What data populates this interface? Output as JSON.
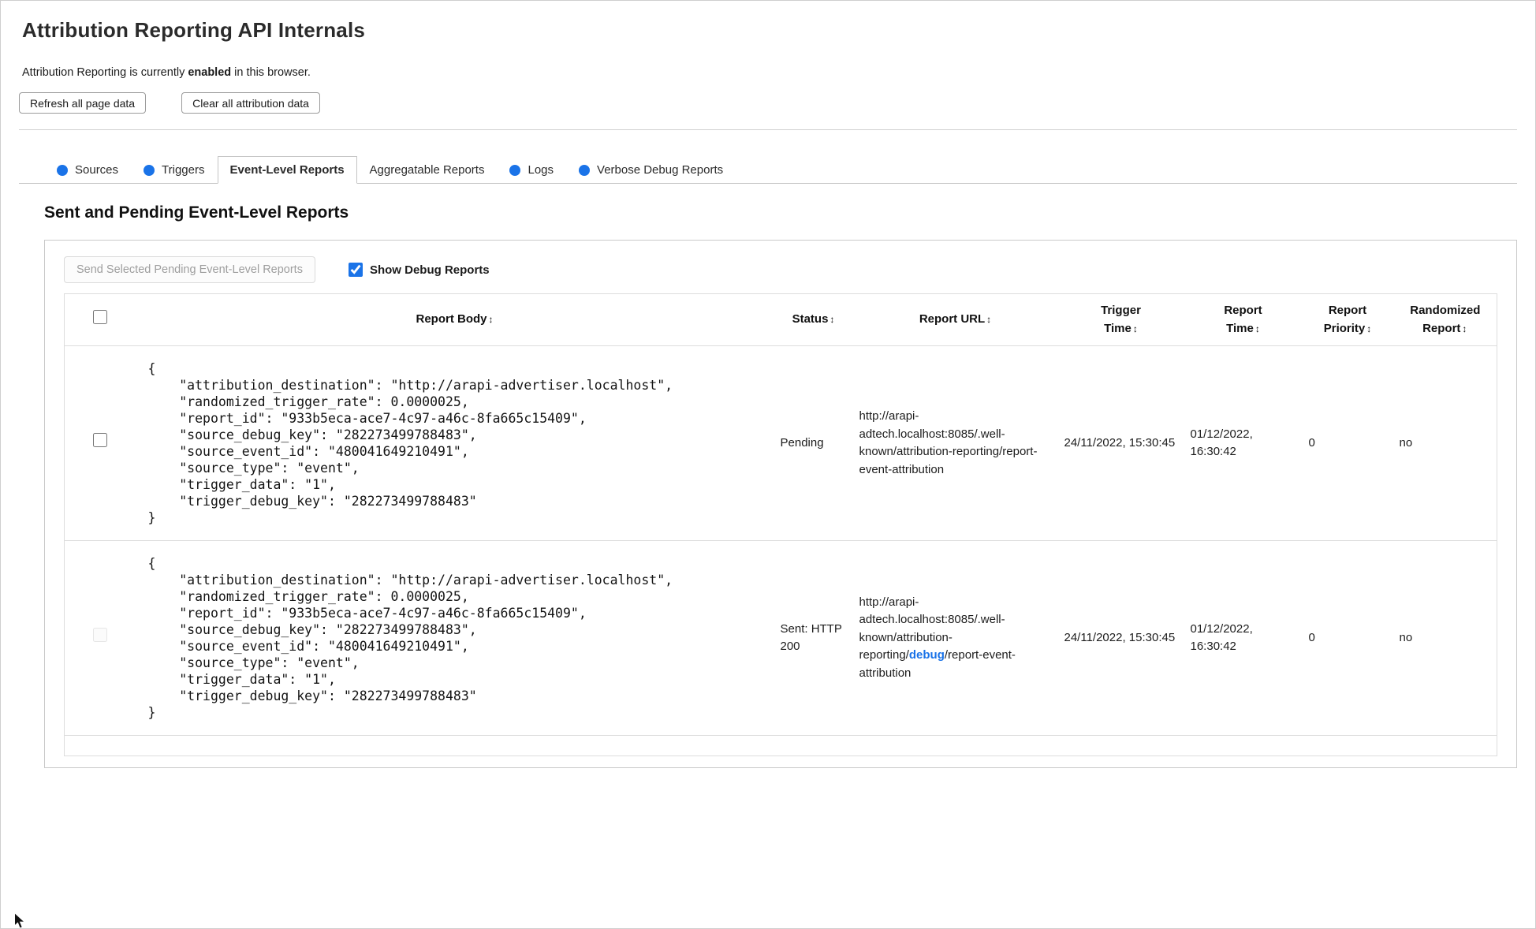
{
  "page": {
    "title": "Attribution Reporting API Internals",
    "status": {
      "prefix": "Attribution Reporting is currently ",
      "emphasis": "enabled",
      "suffix": " in this browser."
    },
    "buttons": {
      "refresh": "Refresh all page data",
      "clear": "Clear all attribution data"
    }
  },
  "colors": {
    "accent_blue": "#1a73e8"
  },
  "tabs": [
    {
      "label": "Sources",
      "has_dot": true,
      "active": false
    },
    {
      "label": "Triggers",
      "has_dot": true,
      "active": false
    },
    {
      "label": "Event-Level Reports",
      "has_dot": false,
      "active": true
    },
    {
      "label": "Aggregatable Reports",
      "has_dot": false,
      "active": false
    },
    {
      "label": "Logs",
      "has_dot": true,
      "active": false
    },
    {
      "label": "Verbose Debug Reports",
      "has_dot": true,
      "active": false
    }
  ],
  "section": {
    "heading": "Sent and Pending Event-Level Reports",
    "send_button": "Send Selected Pending Event-Level Reports",
    "send_button_enabled": false,
    "show_debug_label": "Show Debug Reports",
    "show_debug_checked": true
  },
  "table": {
    "sort_icon": "↕",
    "headers": [
      {
        "label": "Report Body",
        "sortable": true
      },
      {
        "label": "Status",
        "sortable": true
      },
      {
        "label": "Report URL",
        "sortable": true
      },
      {
        "label": "Trigger Time",
        "sortable": true
      },
      {
        "label": "Report Time",
        "sortable": true
      },
      {
        "label": "Report Priority",
        "sortable": true
      },
      {
        "label": "Randomized Report",
        "sortable": true
      }
    ],
    "rows": [
      {
        "selected": false,
        "checkbox_enabled": true,
        "report_body": "{\n    \"attribution_destination\": \"http://arapi-advertiser.localhost\",\n    \"randomized_trigger_rate\": 0.0000025,\n    \"report_id\": \"933b5eca-ace7-4c97-a46c-8fa665c15409\",\n    \"source_debug_key\": \"282273499788483\",\n    \"source_event_id\": \"480041649210491\",\n    \"source_type\": \"event\",\n    \"trigger_data\": \"1\",\n    \"trigger_debug_key\": \"282273499788483\"\n}",
        "status": "Pending",
        "report_url": {
          "prefix": "http://arapi-adtech.localhost:8085/.well-known/attribution-reporting/",
          "highlight": "",
          "suffix": "report-event-attribution"
        },
        "trigger_time": "24/11/2022, 15:30:45",
        "report_time": "01/12/2022, 16:30:42",
        "report_priority": "0",
        "randomized_report": "no"
      },
      {
        "selected": false,
        "checkbox_enabled": false,
        "report_body": "{\n    \"attribution_destination\": \"http://arapi-advertiser.localhost\",\n    \"randomized_trigger_rate\": 0.0000025,\n    \"report_id\": \"933b5eca-ace7-4c97-a46c-8fa665c15409\",\n    \"source_debug_key\": \"282273499788483\",\n    \"source_event_id\": \"480041649210491\",\n    \"source_type\": \"event\",\n    \"trigger_data\": \"1\",\n    \"trigger_debug_key\": \"282273499788483\"\n}",
        "status": "Sent: HTTP 200",
        "report_url": {
          "prefix": "http://arapi-adtech.localhost:8085/.well-known/attribution-reporting/",
          "highlight": "debug",
          "suffix": "/report-event-attribution"
        },
        "trigger_time": "24/11/2022, 15:30:45",
        "report_time": "01/12/2022, 16:30:42",
        "report_priority": "0",
        "randomized_report": "no"
      }
    ]
  }
}
